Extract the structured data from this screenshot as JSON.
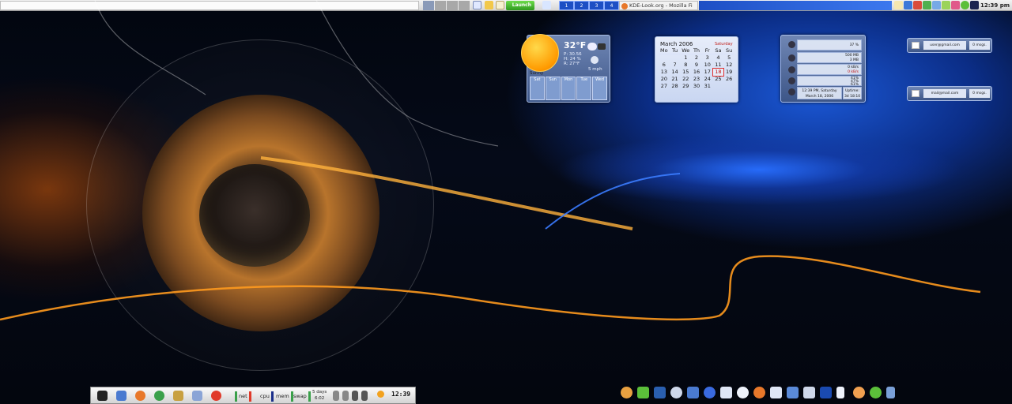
{
  "top_panel": {
    "launch_label": "Launch",
    "desktops": [
      "1",
      "2",
      "3",
      "4"
    ],
    "task_title": "KDE-Look.org - Mozilla Fi",
    "clock": "12:39 pm"
  },
  "weather": {
    "temp": "32°F",
    "pressure": "P: 30.56",
    "humidity": "H: 24 %",
    "feels": "R: 27°F",
    "wind": "5 mph",
    "condition": "Sunny",
    "days": [
      "Sat",
      "Sun",
      "Mon",
      "Tue",
      "Wed"
    ]
  },
  "calendar": {
    "month": "March 2006",
    "today_label": "Saturday",
    "headers": [
      "Mo",
      "Tu",
      "We",
      "Th",
      "Fr",
      "Sa",
      "Su"
    ],
    "rows": [
      [
        "",
        "",
        "1",
        "2",
        "3",
        "4",
        "5"
      ],
      [
        "6",
        "7",
        "8",
        "9",
        "10",
        "11",
        "12"
      ],
      [
        "13",
        "14",
        "15",
        "16",
        "17",
        "18",
        "19"
      ],
      [
        "20",
        "21",
        "22",
        "23",
        "24",
        "25",
        "26"
      ],
      [
        "27",
        "28",
        "29",
        "30",
        "31",
        "",
        ""
      ]
    ],
    "marked_day": "18"
  },
  "sysmon": {
    "cpu": "37 %",
    "mem": "500 MB",
    "mem2": "3 MB",
    "net": "0 kB/s",
    "net2": "0 kB/s",
    "disk1": "41%",
    "disk2": "47%",
    "disk3": "61%",
    "datetime": "12:39 PM, Saturday",
    "date": "March 18, 2006",
    "uptime_label": "Uptime:",
    "uptime": "3d 18:10"
  },
  "mail": [
    {
      "address": "user@gmail.com",
      "count": "0 msgs."
    },
    {
      "address": "mail@mail.com",
      "count": "0 msgs."
    }
  ],
  "bottom_panel": {
    "net_label": "net",
    "cpu_label": "cpu",
    "mem_label": "mem",
    "swap_label": "swap",
    "uptime_days": "5 days",
    "uptime_time": "6:02",
    "clock": "12:39"
  }
}
